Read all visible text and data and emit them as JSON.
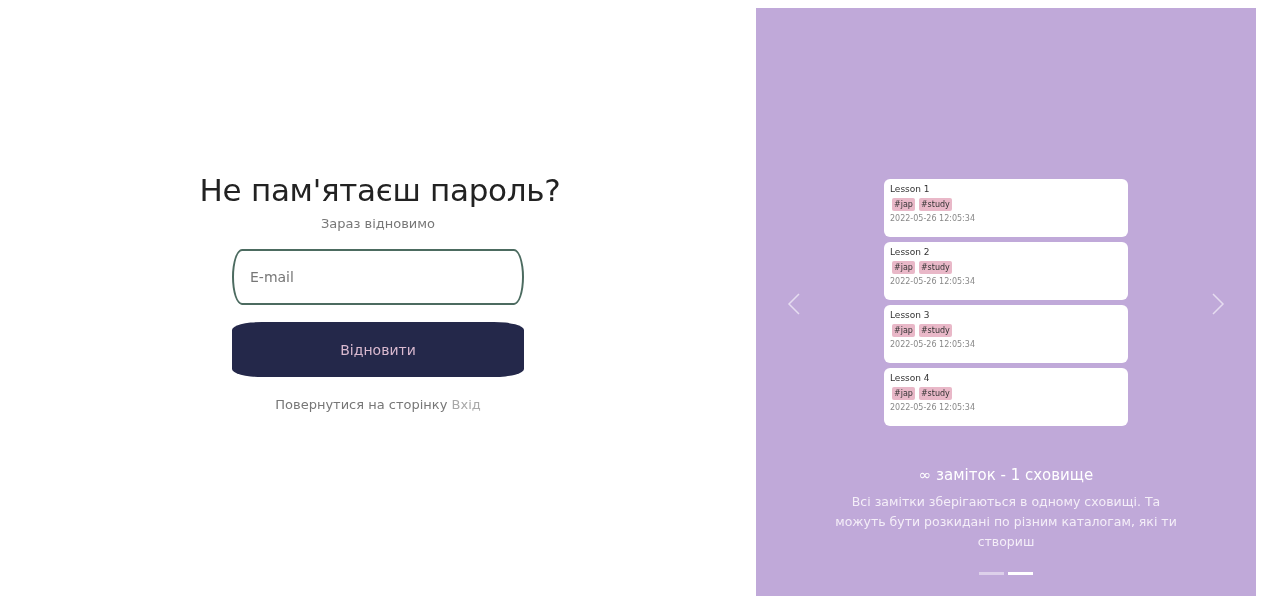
{
  "form": {
    "title": "Не пам'ятаєш пароль?",
    "subtitle": "Зараз відновимо",
    "email": {
      "placeholder": "E-mail"
    },
    "submit": "Відновити",
    "back": {
      "text": "Повернутися на сторінку",
      "link": "Вхід"
    }
  },
  "carousel": {
    "notes": [
      {
        "title": "Lesson 1",
        "tags": [
          "#jap",
          "#study"
        ],
        "date": "2022-05-26 12:05:34"
      },
      {
        "title": "Lesson 2",
        "tags": [
          "#jap",
          "#study"
        ],
        "date": "2022-05-26 12:05:34"
      },
      {
        "title": "Lesson 3",
        "tags": [
          "#jap",
          "#study"
        ],
        "date": "2022-05-26 12:05:34"
      },
      {
        "title": "Lesson 4",
        "tags": [
          "#jap",
          "#study"
        ],
        "date": "2022-05-26 12:05:34"
      }
    ],
    "heading": "∞ заміток - 1 сховище",
    "text": "Всі замітки зберігаються в одному сховищі. Та можуть бути розкидані по різним каталогам, які ти створиш",
    "indicators": [
      {
        "selected": false
      },
      {
        "selected": true
      }
    ]
  }
}
